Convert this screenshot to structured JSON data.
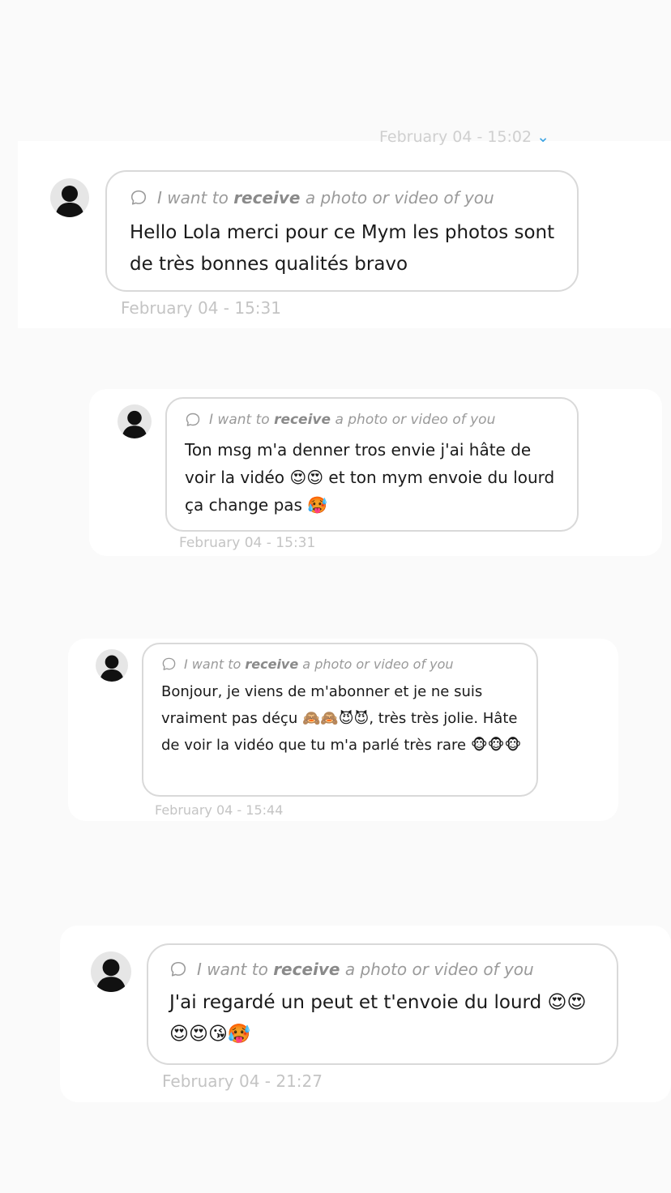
{
  "colors": {
    "accent": "#3aa3e3",
    "timestamp": "#c4c4c4",
    "bubble_border": "#d9d9d9",
    "request_text": "#9a9a9a"
  },
  "header_timestamp": "February 04 - 15:02",
  "request_label": {
    "before": "I want to",
    "bold": "receive",
    "after": "a photo or video of you"
  },
  "messages": [
    {
      "text": "Hello Lola merci pour ce Mym les photos sont de très bonnes qualités bravo",
      "timestamp": "February 04 - 15:31"
    },
    {
      "text": "Ton msg m'a denner tros envie j'ai hâte de voir la vidéo 😍😍 et ton mym envoie du lourd ça change pas 🥵",
      "timestamp": "February 04 - 15:31"
    },
    {
      "text": "Bonjour, je viens de m'abonner et je ne suis vraiment pas déçu 🙈🙈😈😈, très très jolie. Hâte de voir la vidéo que tu m'a parlé très rare 🐵🐵🐵",
      "timestamp": "February 04 - 15:44"
    },
    {
      "text": "J'ai regardé un peut et t'envoie du lourd 😍😍😍😍😘🥵",
      "timestamp": "February 04 - 21:27"
    }
  ]
}
